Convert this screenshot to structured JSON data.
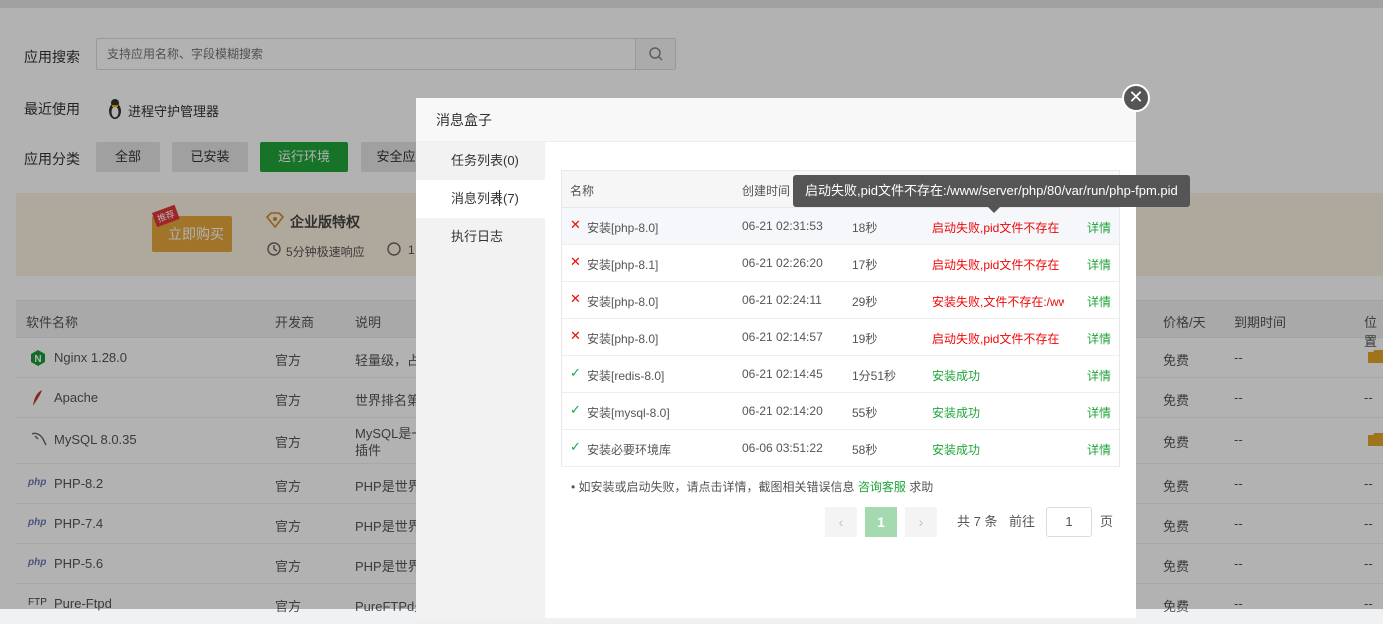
{
  "search": {
    "label": "应用搜索",
    "placeholder": "支持应用名称、字段模糊搜索"
  },
  "recent": {
    "label": "最近使用",
    "item": "进程守护管理器"
  },
  "category": {
    "label": "应用分类",
    "items": [
      "全部",
      "已安装",
      "运行环境",
      "安全应"
    ],
    "active": "运行环境"
  },
  "banner": {
    "tag": "推荐",
    "buy": "立即购买",
    "enterprise": "企业版特权",
    "response": "5分钟极速响应",
    "extra": "1"
  },
  "table": {
    "headers": [
      "软件名称",
      "开发商",
      "说明",
      "价格/天",
      "到期时间",
      "位置"
    ],
    "rows": [
      {
        "name": "Nginx 1.28.0",
        "vendor": "官方",
        "desc": "轻量级，占",
        "price": "免费",
        "expire": "--",
        "icon": "nginx-icon"
      },
      {
        "name": "Apache",
        "vendor": "官方",
        "desc": "世界排名第",
        "price": "免费",
        "expire": "--",
        "pos": "--",
        "icon": "feather-icon"
      },
      {
        "name": "MySQL 8.0.35",
        "vendor": "官方",
        "desc": "MySQL是一",
        "desc2": "插件",
        "price": "免费",
        "expire": "--",
        "icon": "dolphin-icon"
      },
      {
        "name": "PHP-8.2",
        "vendor": "官方",
        "desc": "PHP是世界",
        "price": "免费",
        "expire": "--",
        "pos": "--",
        "icon": "php-icon"
      },
      {
        "name": "PHP-7.4",
        "vendor": "官方",
        "desc": "PHP是世界",
        "price": "免费",
        "expire": "--",
        "pos": "--",
        "icon": "php-icon"
      },
      {
        "name": "PHP-5.6",
        "vendor": "官方",
        "desc": "PHP是世界",
        "price": "免费",
        "expire": "--",
        "pos": "--",
        "icon": "php-icon"
      },
      {
        "name": "Pure-Ftpd",
        "vendor": "官方",
        "desc": "PureFTPd是",
        "price": "免费",
        "expire": "--",
        "pos": "--",
        "icon": "ftp-icon"
      }
    ]
  },
  "modal": {
    "title": "消息盒子",
    "tabs": [
      "任务列表(0)",
      "消息列表(7)",
      "执行日志"
    ],
    "headers": [
      "名称",
      "创建时间"
    ],
    "rows": [
      {
        "name": "安装[php-8.0]",
        "time": "06-21 02:31:53",
        "dur": "18秒",
        "status": "启动失败,pid文件不存在",
        "ok": false,
        "detail": "详情"
      },
      {
        "name": "安装[php-8.1]",
        "time": "06-21 02:26:20",
        "dur": "17秒",
        "status": "启动失败,pid文件不存在",
        "ok": false,
        "detail": "详情"
      },
      {
        "name": "安装[php-8.0]",
        "time": "06-21 02:24:11",
        "dur": "29秒",
        "status": "安装失败,文件不存在:/ww",
        "ok": false,
        "detail": "详情"
      },
      {
        "name": "安装[php-8.0]",
        "time": "06-21 02:14:57",
        "dur": "19秒",
        "status": "启动失败,pid文件不存在",
        "ok": false,
        "detail": "详情"
      },
      {
        "name": "安装[redis-8.0]",
        "time": "06-21 02:14:45",
        "dur": "1分51秒",
        "status": "安装成功",
        "ok": true,
        "detail": "详情"
      },
      {
        "name": "安装[mysql-8.0]",
        "time": "06-21 02:14:20",
        "dur": "55秒",
        "status": "安装成功",
        "ok": true,
        "detail": "详情"
      },
      {
        "name": "安装必要环境库",
        "time": "06-06 03:51:22",
        "dur": "58秒",
        "status": "安装成功",
        "ok": true,
        "detail": "详情"
      }
    ],
    "note_prefix": "• 如安装或启动失败，请点击详情，截图相关错误信息",
    "note_link": "咨询客服",
    "note_suffix": "求助",
    "pager": {
      "prev": "‹",
      "current": "1",
      "next": "›",
      "total": "共 7 条",
      "goto": "前往",
      "page_value": "1",
      "page_unit": "页"
    },
    "tooltip": "启动失败,pid文件不存在:/www/server/php/80/var/run/php-fpm.pid"
  },
  "colors": {
    "accent": "#20a53a",
    "error": "#ef0808",
    "overlay": "rgba(0,0,0,0.30)"
  }
}
